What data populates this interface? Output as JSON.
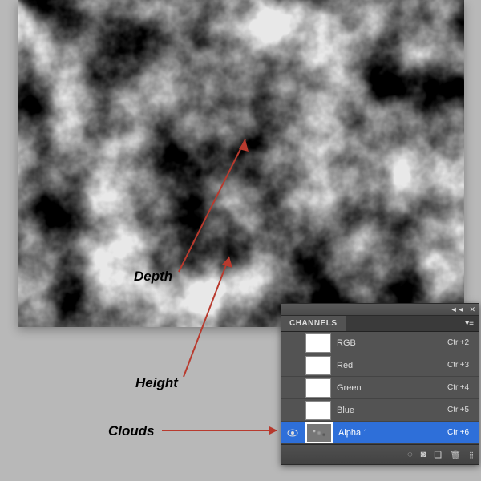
{
  "annotations": {
    "depth": "Depth",
    "height": "Height",
    "clouds": "Clouds"
  },
  "panel": {
    "tab": "CHANNELS",
    "rows": [
      {
        "name": "RGB",
        "shortcut": "Ctrl+2",
        "selected": false,
        "visible": false,
        "thumb": "white"
      },
      {
        "name": "Red",
        "shortcut": "Ctrl+3",
        "selected": false,
        "visible": false,
        "thumb": "white"
      },
      {
        "name": "Green",
        "shortcut": "Ctrl+4",
        "selected": false,
        "visible": false,
        "thumb": "white"
      },
      {
        "name": "Blue",
        "shortcut": "Ctrl+5",
        "selected": false,
        "visible": false,
        "thumb": "white"
      },
      {
        "name": "Alpha 1",
        "shortcut": "Ctrl+6",
        "selected": true,
        "visible": true,
        "thumb": "noise"
      }
    ]
  }
}
